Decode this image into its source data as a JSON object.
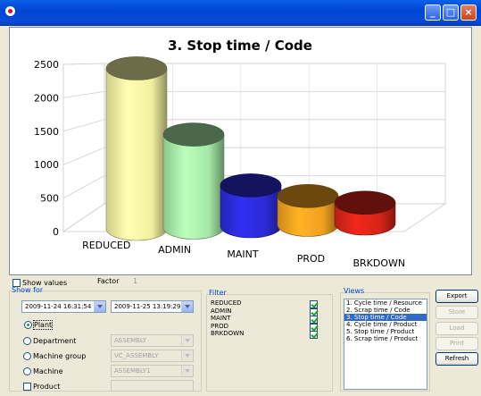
{
  "window": {
    "title": ""
  },
  "chart_data": {
    "type": "bar",
    "title": "3. Stop time / Code",
    "categories": [
      "REDUCED",
      "ADMIN",
      "MAINT",
      "PROD",
      "BRKDOWN"
    ],
    "values": [
      2400,
      1390,
      610,
      430,
      310
    ],
    "colors": [
      "#f2f0a0",
      "#a6e8a6",
      "#2b2bd6",
      "#f0a020",
      "#d82418"
    ],
    "ylim": [
      0,
      2500
    ],
    "yticks": [
      0,
      500,
      1000,
      1500,
      2000,
      2500
    ],
    "grid": true,
    "style": "3d-cylinder"
  },
  "options": {
    "show_values_label": "Show values",
    "factor_label": "Factor",
    "factor_value": "1"
  },
  "show_for": {
    "title": "Show for",
    "date_from": "2009-11-24 16:31:54",
    "date_to": "2009-11-25 13:19:29",
    "plant_label": "Plant",
    "department_label": "Department",
    "department_value": "ASSEMBLY",
    "machine_group_label": "Machine group",
    "machine_group_value": "VC_ASSEMBLY",
    "machine_label": "Machine",
    "machine_value": "ASSEMBLY1",
    "product_label": "Product"
  },
  "filter": {
    "title": "Filter",
    "items": [
      "REDUCED",
      "ADMIN",
      "MAINT",
      "PROD",
      "BRKDOWN"
    ]
  },
  "views": {
    "title": "Views",
    "items": [
      "1. Cycle time / Resource",
      "2. Scrap time / Code",
      "3. Stop time / Code",
      "4. Cycle time / Product",
      "5. Stop time / Product",
      "6. Scrap time / Product"
    ],
    "selected_index": 2
  },
  "buttons": {
    "export": "Export",
    "store": "Store",
    "load": "Load",
    "print": "Print",
    "refresh": "Refresh"
  }
}
